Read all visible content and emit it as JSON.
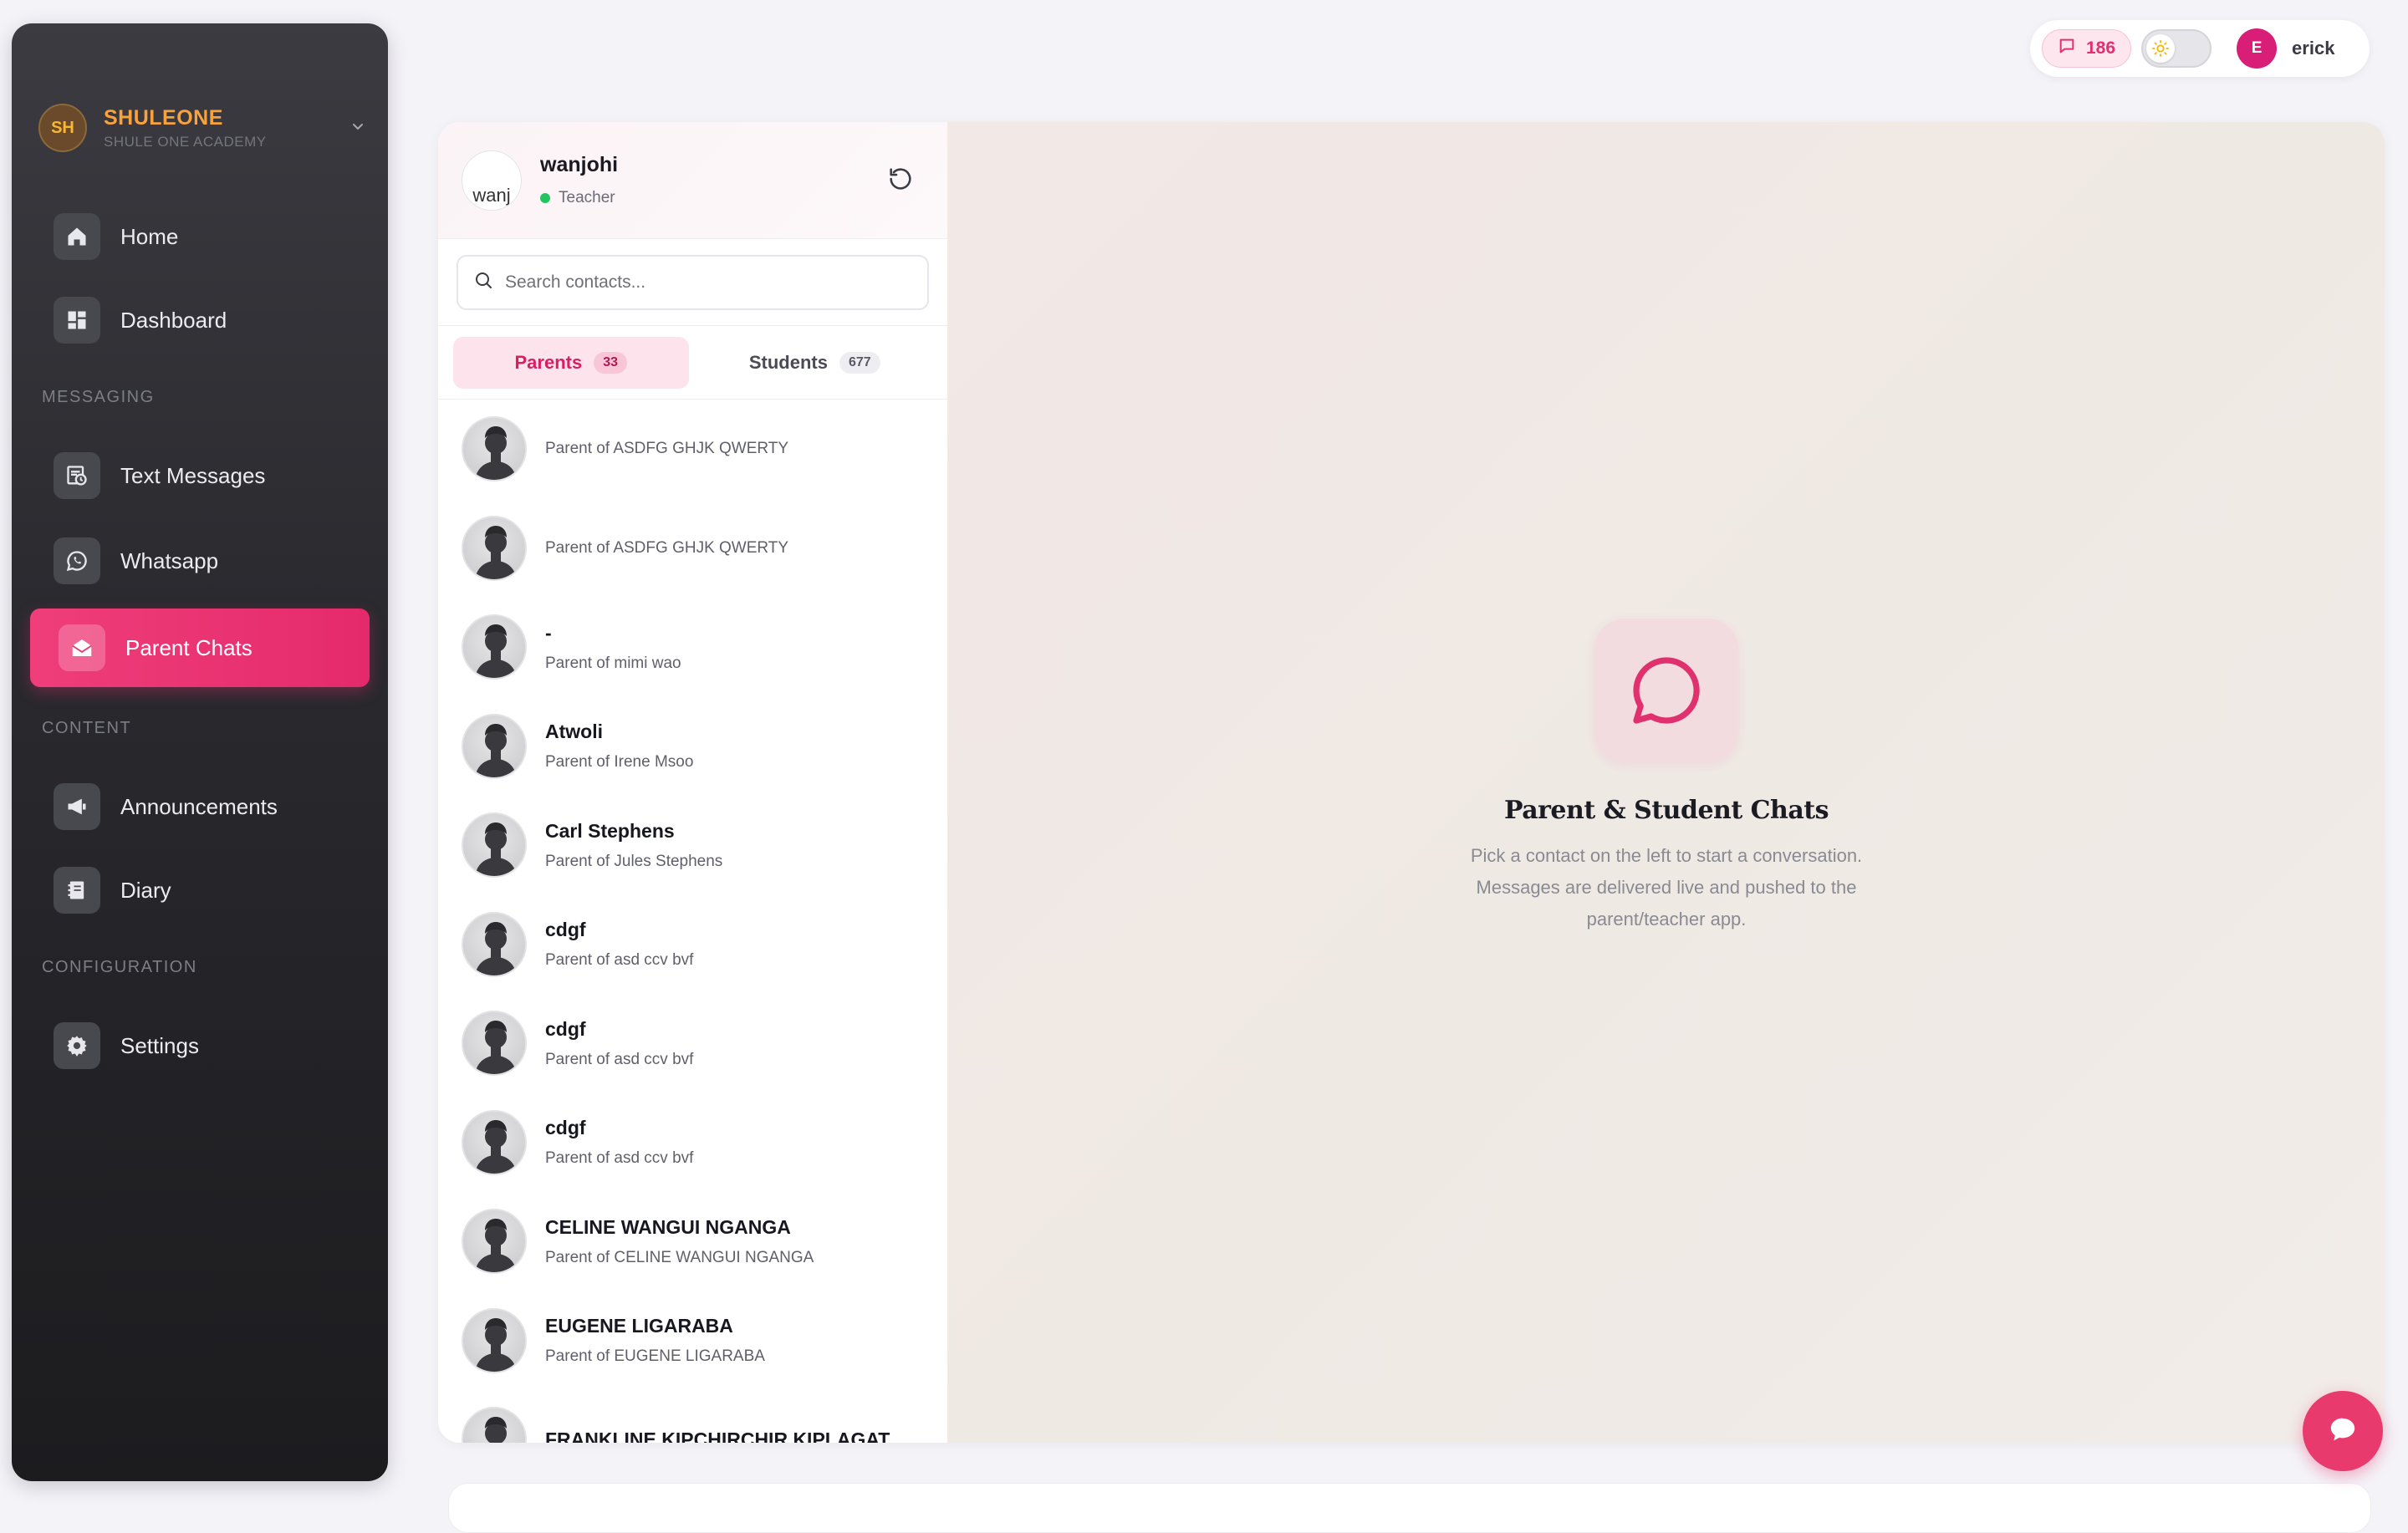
{
  "brand": {
    "initials": "SH",
    "name": "SHULEONE",
    "subtitle": "SHULE ONE ACADEMY"
  },
  "sidebar": {
    "items": [
      {
        "label": "Home",
        "icon": "home-icon"
      },
      {
        "label": "Dashboard",
        "icon": "dashboard-icon"
      }
    ],
    "sections": {
      "messaging": "MESSAGING",
      "content": "CONTENT",
      "configuration": "CONFIGURATION"
    },
    "messaging_items": [
      {
        "label": "Text Messages",
        "icon": "sms-icon"
      },
      {
        "label": "Whatsapp",
        "icon": "whatsapp-icon"
      },
      {
        "label": "Parent Chats",
        "icon": "envelope-open-icon",
        "active": true
      }
    ],
    "content_items": [
      {
        "label": "Announcements",
        "icon": "megaphone-icon"
      },
      {
        "label": "Diary",
        "icon": "diary-icon"
      }
    ],
    "config_items": [
      {
        "label": "Settings",
        "icon": "gear-icon"
      }
    ]
  },
  "topbar": {
    "message_count": "186",
    "user_initial": "E",
    "user_name": "erick"
  },
  "me": {
    "avatar_alt": "wanj",
    "name": "wanjohi",
    "role": "Teacher"
  },
  "search": {
    "placeholder": "Search contacts..."
  },
  "tabs": [
    {
      "label": "Parents",
      "count": "33",
      "active": true
    },
    {
      "label": "Students",
      "count": "677",
      "active": false
    }
  ],
  "contacts": [
    {
      "name": "",
      "sub": "Parent of ASDFG GHJK QWERTY"
    },
    {
      "name": "",
      "sub": "Parent of ASDFG GHJK QWERTY"
    },
    {
      "name": "-",
      "sub": "Parent of mimi wao"
    },
    {
      "name": "Atwoli",
      "sub": "Parent of Irene Msoo"
    },
    {
      "name": "Carl Stephens",
      "sub": "Parent of Jules Stephens"
    },
    {
      "name": "cdgf",
      "sub": "Parent of asd ccv bvf"
    },
    {
      "name": "cdgf",
      "sub": "Parent of asd ccv bvf"
    },
    {
      "name": "cdgf",
      "sub": "Parent of asd ccv bvf"
    },
    {
      "name": "CELINE WANGUI NGANGA",
      "sub": "Parent of CELINE WANGUI NGANGA"
    },
    {
      "name": "EUGENE LIGARABA",
      "sub": "Parent of EUGENE LIGARABA"
    },
    {
      "name": "FRANKLINE KIPCHIRCHIR KIPLAGAT",
      "sub": ""
    }
  ],
  "empty_state": {
    "title": "Parent & Student Chats",
    "description": "Pick a contact on the left to start a conversation. Messages are delivered live and pushed to the parent/teacher app."
  },
  "colors": {
    "accent": "#e83a6c",
    "brand": "#f7a23c",
    "online": "#22c55e"
  }
}
